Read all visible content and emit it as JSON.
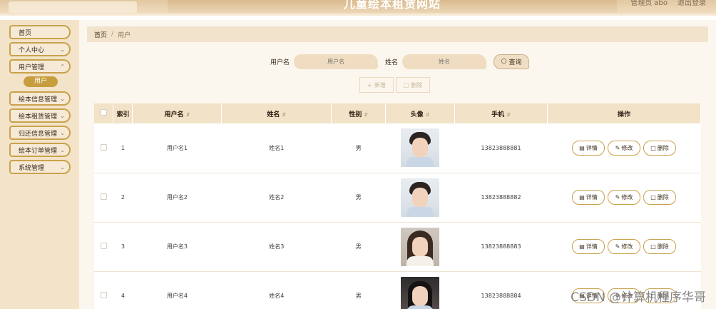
{
  "header": {
    "site_title": "儿童绘本租赁网站",
    "user_label": "管理员 abo",
    "logout_label": "退出登录"
  },
  "sidebar": {
    "items": [
      {
        "label": "首页",
        "has_chevron": false
      },
      {
        "label": "个人中心",
        "has_chevron": true
      },
      {
        "label": "用户管理",
        "has_chevron": true
      }
    ],
    "sub_item": "用户",
    "items_after": [
      {
        "label": "绘本信息管理"
      },
      {
        "label": "绘本租赁管理"
      },
      {
        "label": "归还信息管理"
      },
      {
        "label": "绘本订单管理"
      },
      {
        "label": "系统管理"
      }
    ]
  },
  "breadcrumb": {
    "home": "首页",
    "sep": "/",
    "current": "用户"
  },
  "search": {
    "username_label": "用户名",
    "username_placeholder": "用户名",
    "name_label": "姓名",
    "name_placeholder": "姓名",
    "button_label": "查询"
  },
  "actions": {
    "add_label": "新增",
    "delete_label": "删除"
  },
  "table": {
    "headers": [
      "索引",
      "用户名",
      "姓名",
      "性别",
      "头像",
      "手机",
      "操作"
    ],
    "rows": [
      {
        "index": "1",
        "username": "用户名1",
        "name": "姓名1",
        "gender": "男",
        "phone": "13823888881",
        "avatar": "male"
      },
      {
        "index": "2",
        "username": "用户名2",
        "name": "姓名2",
        "gender": "男",
        "phone": "13823888882",
        "avatar": "male"
      },
      {
        "index": "3",
        "username": "用户名3",
        "name": "姓名3",
        "gender": "男",
        "phone": "13823888883",
        "avatar": "female"
      },
      {
        "index": "4",
        "username": "用户名4",
        "name": "姓名4",
        "gender": "男",
        "phone": "13823888884",
        "avatar": "dark"
      }
    ],
    "op_detail": "详情",
    "op_edit": "修改",
    "op_delete": "删除"
  },
  "watermark": "CSDN @计算机程序华哥"
}
